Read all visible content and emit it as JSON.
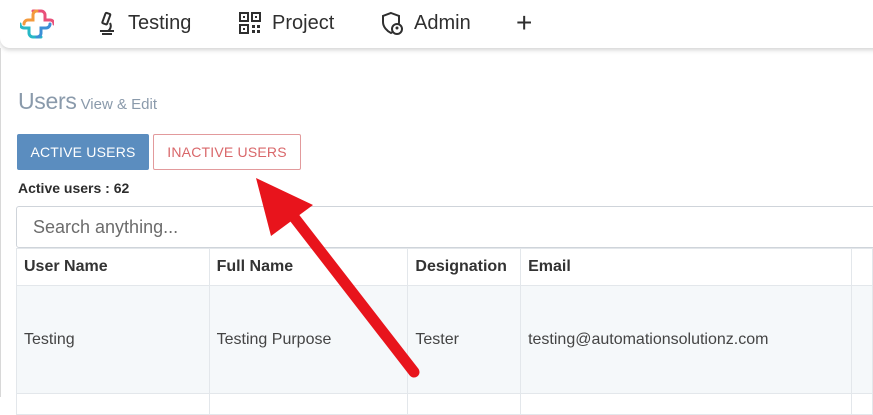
{
  "nav": {
    "items": [
      {
        "label": "Testing",
        "icon": "microscope-icon"
      },
      {
        "label": "Project",
        "icon": "qr-code-icon"
      },
      {
        "label": "Admin",
        "icon": "shield-user-icon"
      }
    ],
    "add_label": "+"
  },
  "page": {
    "title": "Users",
    "subtitle": "View & Edit"
  },
  "buttons": {
    "active": "ACTIVE USERS",
    "inactive": "INACTIVE USERS"
  },
  "active_count": "Active users : 62",
  "search": {
    "placeholder": "Search anything..."
  },
  "table": {
    "headers": [
      "User Name",
      "Full Name",
      "Designation",
      "Email"
    ],
    "rows": [
      [
        "Testing",
        "Testing Purpose",
        "Tester",
        "testing@automationsolutionz.com"
      ]
    ]
  },
  "colors": {
    "active_button": "#5b8dbf",
    "inactive_button_text": "#d9676a",
    "annotation_arrow": "#e8141c"
  }
}
